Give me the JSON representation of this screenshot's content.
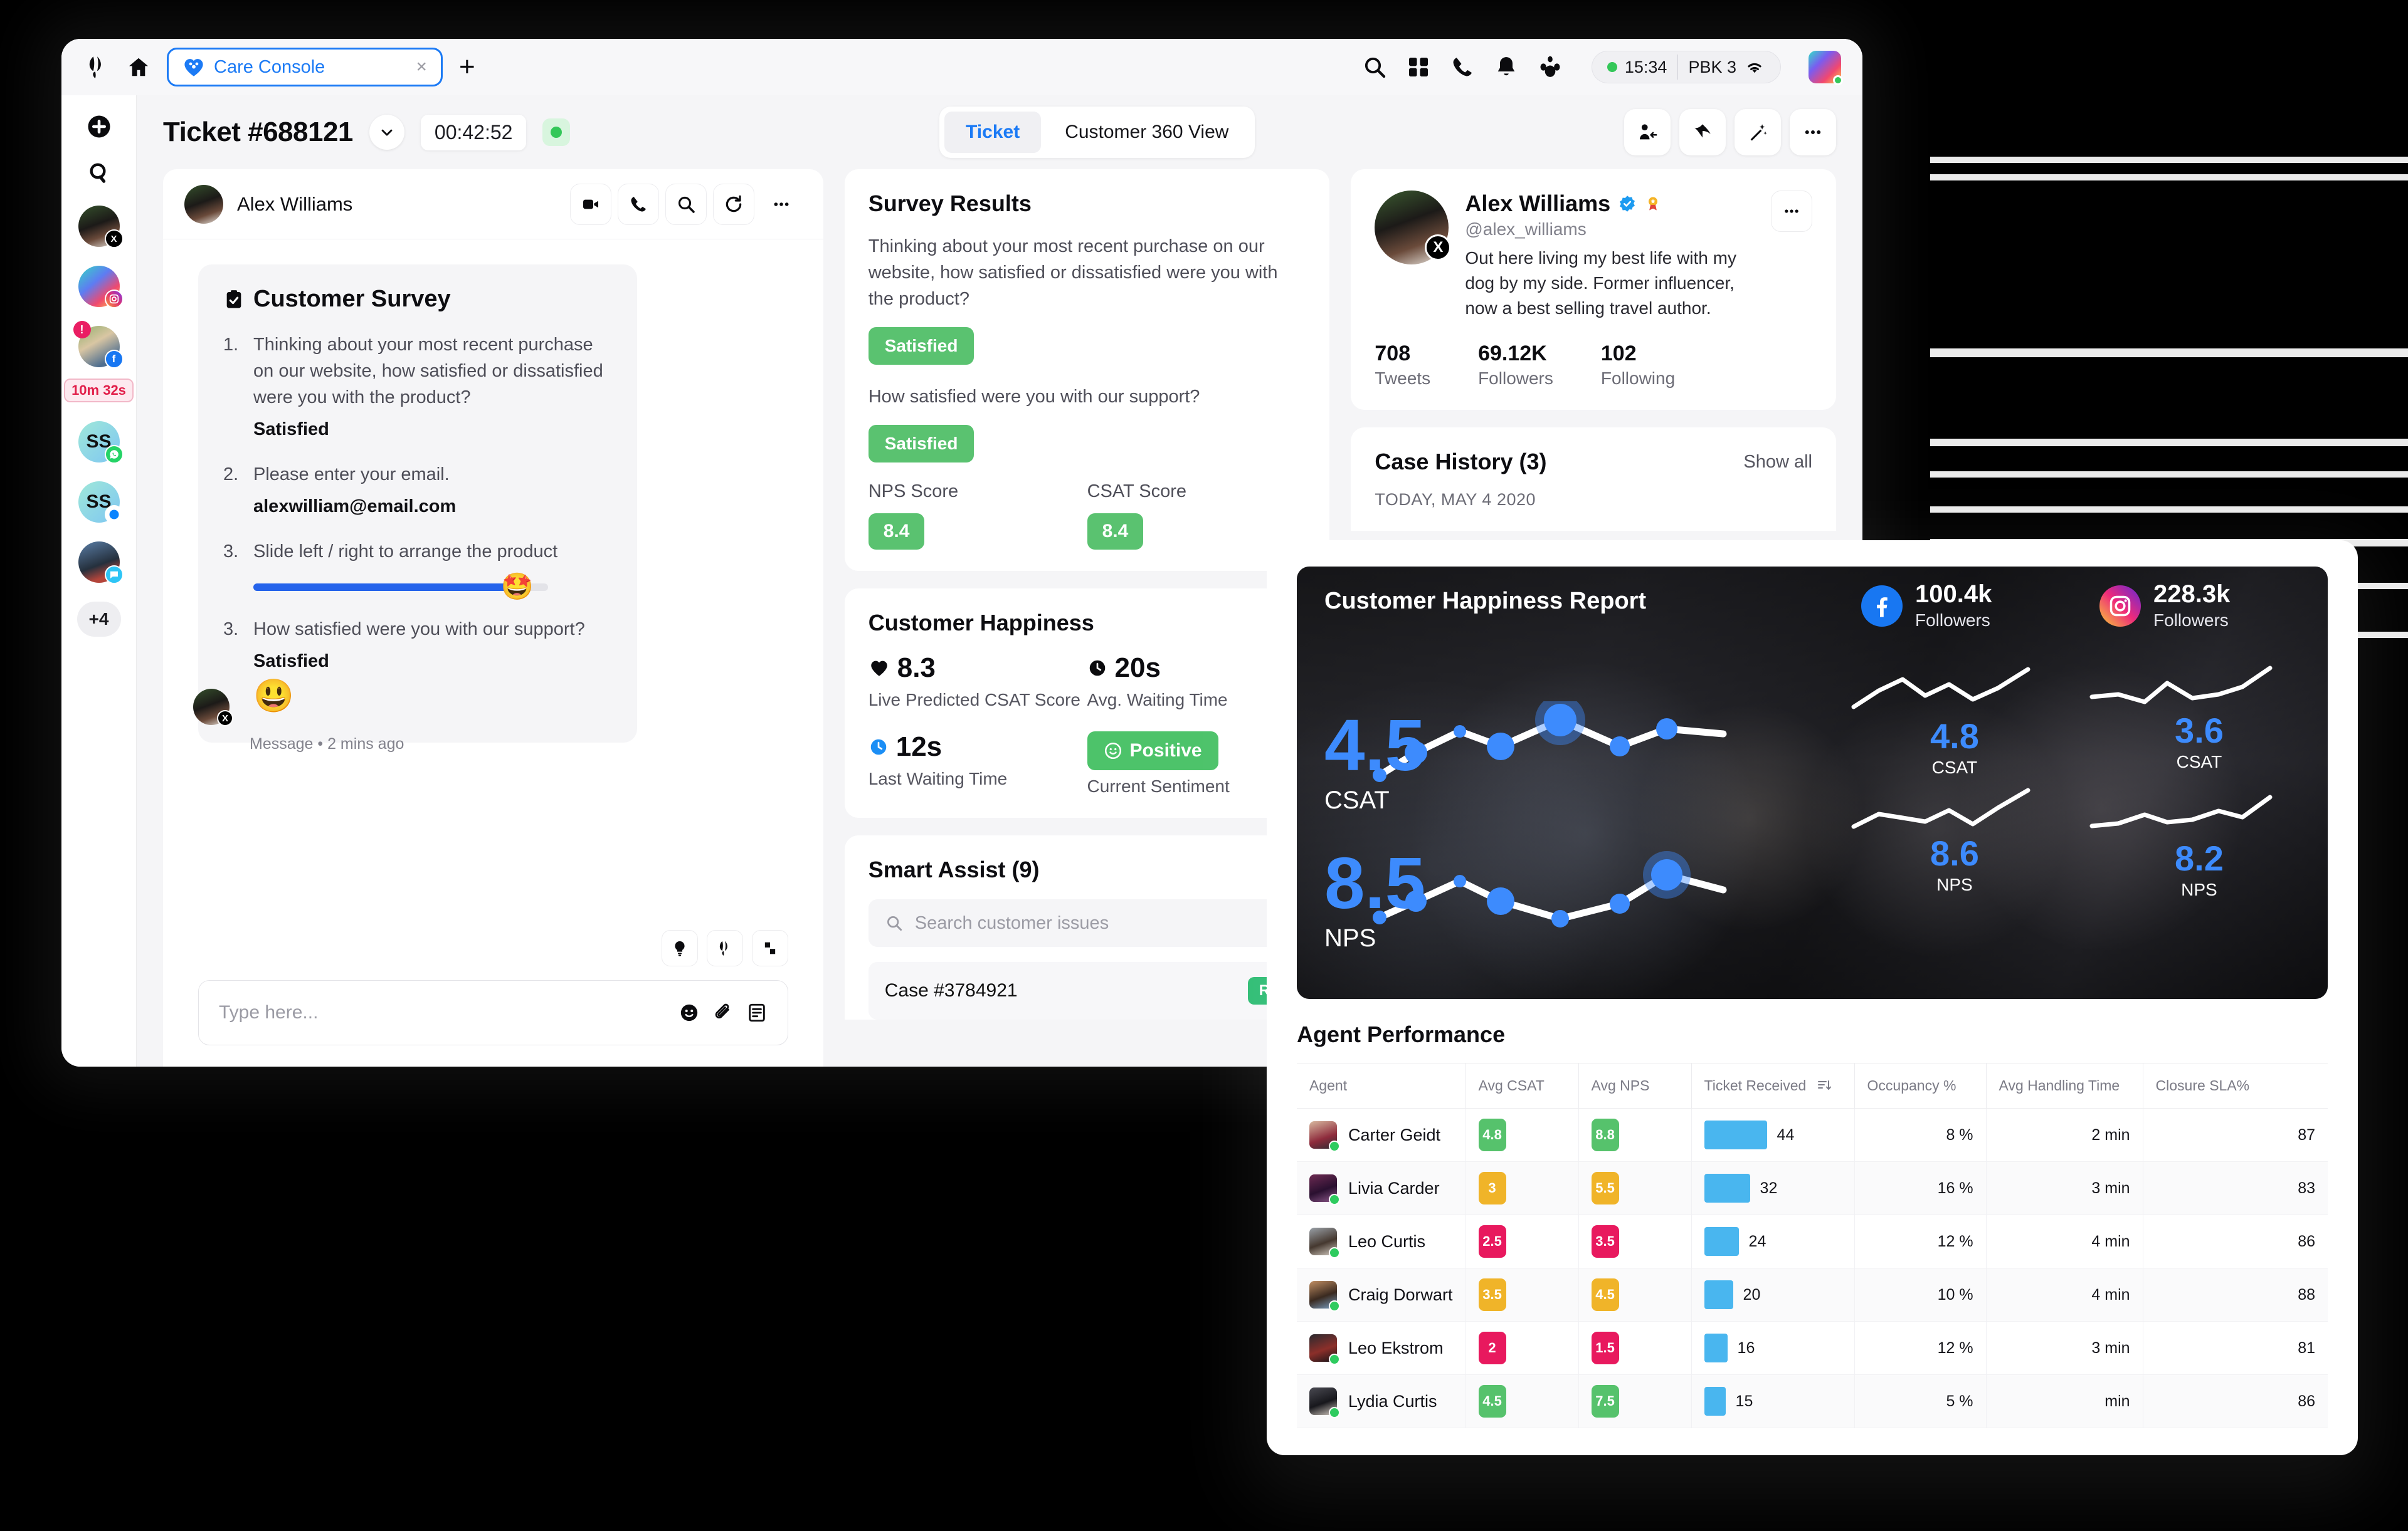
{
  "browser": {
    "tab_title": "Care Console",
    "tab_close": "×",
    "new_tab": "+",
    "status_time": "15:34",
    "status_network": "PBK 3"
  },
  "header": {
    "ticket_title": "Ticket #688121",
    "timer": "00:42:52",
    "tabs": [
      {
        "label": "Ticket",
        "active": true
      },
      {
        "label": "Customer 360 View",
        "active": false
      }
    ]
  },
  "rail": {
    "timer_badge": "10m 32s",
    "initials_1": "SS",
    "initials_2": "SS",
    "more_count": "+4"
  },
  "conversation": {
    "contact_name": "Alex Williams",
    "survey_title": "Customer Survey",
    "questions": [
      {
        "num": "1.",
        "text": "Thinking about your most recent purchase on our website, how satisfied or dissatisfied were you with the product?",
        "answer": "Satisfied"
      },
      {
        "num": "2.",
        "text": "Please enter your email.",
        "answer": "alexwilliam@email.com"
      },
      {
        "num": "3.",
        "text": "Slide left / right to arrange the product",
        "answer": ""
      },
      {
        "num": "3.",
        "text": "How satisfied were you with our support?",
        "answer": "Satisfied"
      }
    ],
    "slider_emoji": "🤩",
    "reaction_emoji": "😃",
    "message_meta": "Message • 2 mins ago",
    "composer_placeholder": "Type here..."
  },
  "survey_results": {
    "title": "Survey Results",
    "question": "Thinking about your most recent purchase on our website, how satisfied or dissatisfied were you with the product?",
    "answer_1": "Satisfied",
    "question_2": "How satisfied were you with our support?",
    "answer_2": "Satisfied",
    "nps_label": "NPS Score",
    "nps_value": "8.4",
    "csat_label": "CSAT Score",
    "csat_value": "8.4"
  },
  "customer_happiness": {
    "title": "Customer Happiness",
    "metrics": [
      {
        "value": "8.3",
        "label": "Live Predicted CSAT Score",
        "icon": "heart-icon"
      },
      {
        "value": "20s",
        "label": "Avg. Waiting Time",
        "icon": "clock-icon"
      },
      {
        "value": "12s",
        "label": "Last Waiting Time",
        "icon": "clock-blue-icon"
      }
    ],
    "sentiment_value": "Positive",
    "sentiment_label": "Current Sentiment"
  },
  "smart_assist": {
    "title": "Smart Assist (9)",
    "search_placeholder": "Search customer issues",
    "first_case": "Case #3784921",
    "first_case_tag": "Re"
  },
  "profile": {
    "name": "Alex Williams",
    "handle": "@alex_williams",
    "bio": "Out here living my best life with my dog by my side. Former influencer, now a best selling travel author.",
    "stats": [
      {
        "n": "708",
        "l": "Tweets"
      },
      {
        "n": "69.12K",
        "l": "Followers"
      },
      {
        "n": "102",
        "l": "Following"
      }
    ],
    "case_history_title": "Case History (3)",
    "show_all": "Show all",
    "case_day": "TODAY, MAY 4 2020"
  },
  "report": {
    "hero_title": "Customer Happiness Report",
    "socials": [
      {
        "network": "facebook",
        "count": "100.4k",
        "label": "Followers"
      },
      {
        "network": "instagram",
        "count": "228.3k",
        "label": "Followers"
      }
    ],
    "metrics": [
      {
        "value": "4.5",
        "label": "CSAT",
        "size": "large"
      },
      {
        "value": "8.5",
        "label": "NPS",
        "size": "large"
      },
      {
        "value": "4.8",
        "label": "CSAT",
        "size": "small"
      },
      {
        "value": "8.6",
        "label": "NPS",
        "size": "small"
      },
      {
        "value": "3.6",
        "label": "CSAT",
        "size": "small"
      },
      {
        "value": "8.2",
        "label": "NPS",
        "size": "small"
      }
    ],
    "agent_performance_title": "Agent Performance",
    "columns": [
      "Agent",
      "Avg CSAT",
      "Avg NPS",
      "Ticket Received",
      "Occupancy %",
      "Avg Handling Time",
      "Closure SLA%"
    ],
    "rows": [
      {
        "agent": "Carter Geidt",
        "csat": "4.8",
        "csat_tone": "green",
        "nps": "8.8",
        "nps_tone": "green",
        "tickets": "44",
        "bar_pct": 100,
        "occupancy": "8 %",
        "handling": "2 min",
        "sla": "87"
      },
      {
        "agent": "Livia Carder",
        "csat": "3",
        "csat_tone": "amber",
        "nps": "5.5",
        "nps_tone": "amber",
        "tickets": "32",
        "bar_pct": 73,
        "occupancy": "16 %",
        "handling": "3 min",
        "sla": "83"
      },
      {
        "agent": "Leo Curtis",
        "csat": "2.5",
        "csat_tone": "red",
        "nps": "3.5",
        "nps_tone": "red",
        "tickets": "24",
        "bar_pct": 55,
        "occupancy": "12 %",
        "handling": "4 min",
        "sla": "86"
      },
      {
        "agent": "Craig Dorwart",
        "csat": "3.5",
        "csat_tone": "amber",
        "nps": "4.5",
        "nps_tone": "amber",
        "tickets": "20",
        "bar_pct": 45,
        "occupancy": "10 %",
        "handling": "4 min",
        "sla": "88"
      },
      {
        "agent": "Leo Ekstrom",
        "csat": "2",
        "csat_tone": "red",
        "nps": "1.5",
        "nps_tone": "red",
        "tickets": "16",
        "bar_pct": 36,
        "occupancy": "12 %",
        "handling": "3 min",
        "sla": "81"
      },
      {
        "agent": "Lydia Curtis",
        "csat": "4.5",
        "csat_tone": "green",
        "nps": "7.5",
        "nps_tone": "green",
        "tickets": "15",
        "bar_pct": 33,
        "occupancy": "5 %",
        "handling": "min",
        "sla": "86"
      }
    ]
  },
  "chart_data": [
    {
      "type": "line",
      "title": "Customer Happiness Report — Overall CSAT",
      "series": [
        {
          "name": "CSAT",
          "values": [
            3.6,
            4.2,
            3.9,
            4.5,
            4.1,
            5.0,
            4.3,
            4.6
          ]
        }
      ],
      "x": [
        1,
        2,
        3,
        4,
        5,
        6,
        7,
        8
      ],
      "annotation": "4.5",
      "ylabel": "CSAT",
      "grid": false,
      "legend": "none"
    },
    {
      "type": "line",
      "title": "Customer Happiness Report — Overall NPS",
      "series": [
        {
          "name": "NPS",
          "values": [
            7.8,
            8.3,
            8.0,
            8.6,
            7.9,
            8.2,
            8.9,
            8.5
          ]
        }
      ],
      "x": [
        1,
        2,
        3,
        4,
        5,
        6,
        7,
        8
      ],
      "annotation": "8.5",
      "ylabel": "NPS",
      "grid": false,
      "legend": "none"
    },
    {
      "type": "line",
      "title": "Facebook CSAT trend",
      "series": [
        {
          "name": "CSAT",
          "values": [
            4.1,
            4.6,
            5.0,
            4.4,
            4.8,
            4.3,
            4.7,
            5.3
          ]
        }
      ],
      "x": [
        1,
        2,
        3,
        4,
        5,
        6,
        7,
        8
      ],
      "annotation": "4.8",
      "ylabel": "CSAT",
      "grid": false,
      "legend": "none"
    },
    {
      "type": "line",
      "title": "Facebook NPS trend",
      "series": [
        {
          "name": "NPS",
          "values": [
            8.0,
            8.6,
            8.3,
            8.4,
            8.1,
            8.7,
            8.2,
            9.0
          ]
        }
      ],
      "x": [
        1,
        2,
        3,
        4,
        5,
        6,
        7,
        8
      ],
      "annotation": "8.6",
      "ylabel": "NPS",
      "grid": false,
      "legend": "none"
    },
    {
      "type": "line",
      "title": "Instagram CSAT trend",
      "series": [
        {
          "name": "CSAT",
          "values": [
            3.2,
            3.5,
            3.3,
            3.8,
            3.4,
            3.5,
            3.6,
            4.1
          ]
        }
      ],
      "x": [
        1,
        2,
        3,
        4,
        5,
        6,
        7,
        8
      ],
      "annotation": "3.6",
      "ylabel": "CSAT",
      "grid": false,
      "legend": "none"
    },
    {
      "type": "line",
      "title": "Instagram NPS trend",
      "series": [
        {
          "name": "NPS",
          "values": [
            7.9,
            8.1,
            8.0,
            8.4,
            8.1,
            8.3,
            8.2,
            8.7
          ]
        }
      ],
      "x": [
        1,
        2,
        3,
        4,
        5,
        6,
        7,
        8
      ],
      "annotation": "8.2",
      "ylabel": "NPS",
      "grid": false,
      "legend": "none"
    },
    {
      "type": "bar",
      "title": "Ticket Received by Agent",
      "categories": [
        "Carter Geidt",
        "Livia Carder",
        "Leo Curtis",
        "Craig Dorwart",
        "Leo Ekstrom",
        "Lydia Curtis"
      ],
      "values": [
        44,
        32,
        24,
        20,
        16,
        15
      ],
      "xlabel": "Agent",
      "ylabel": "Ticket Received",
      "ylim": [
        0,
        44
      ]
    }
  ]
}
